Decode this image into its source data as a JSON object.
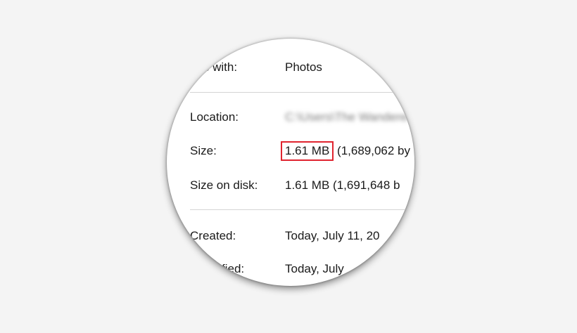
{
  "properties": {
    "opens_with": {
      "label": "ens with:",
      "value": "Photos"
    },
    "location": {
      "label": "Location:",
      "value": "C:\\Users\\The Wanderer"
    },
    "size": {
      "label": "Size:",
      "value_highlight": "1.61 MB",
      "value_rest": "(1,689,062 by"
    },
    "size_on_disk": {
      "label": "Size on disk:",
      "value": "1.61 MB (1,691,648 b"
    },
    "created": {
      "label": "Created:",
      "value": "Today, July 11, 20"
    },
    "modified": {
      "label": "fied:",
      "value": "Today, July"
    }
  },
  "colors": {
    "highlight_border": "#e0242f",
    "divider": "#d4d4d4",
    "background": "#f4f4f4"
  }
}
